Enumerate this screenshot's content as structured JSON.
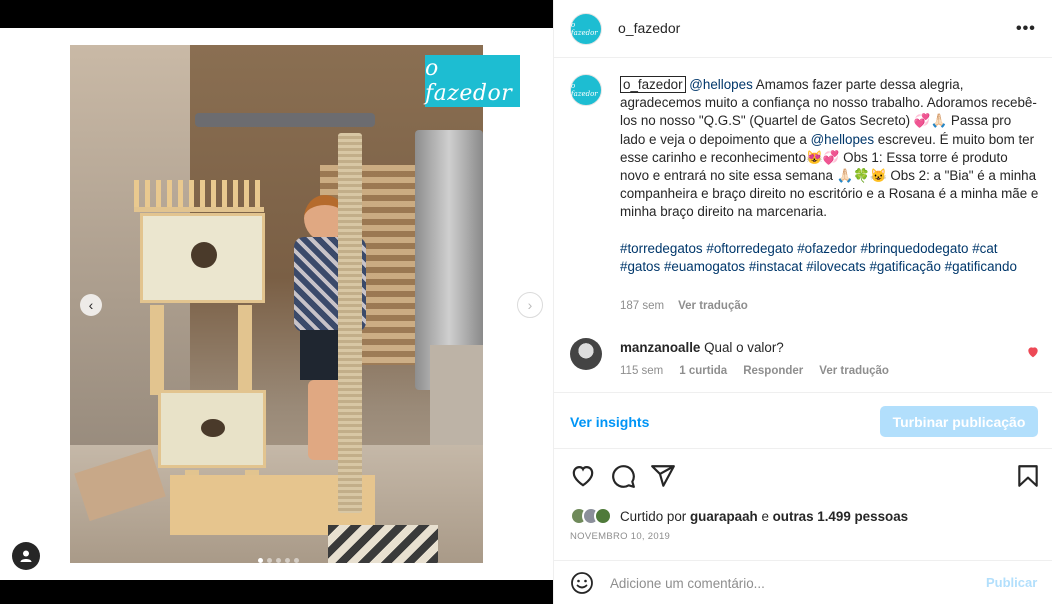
{
  "post": {
    "author": "o_fazedor",
    "logo_text": "o fazedor",
    "more_label": "•••"
  },
  "caption": {
    "username": "o_fazedor",
    "mention1": "@hellopes",
    "text1": " Amamos fazer parte dessa alegria, agradecemos muito a confiança no nosso trabalho. Adoramos recebê-los no nosso \"Q.G.S\" (Quartel de Gatos Secreto) 💞🙏🏻 Passa pro lado e veja o depoimento que a ",
    "mention2": "@hellopes",
    "text2": " escreveu. É muito bom ter esse carinho e reconhecimento😻💞 Obs 1: Essa torre é produto novo e entrará no site essa semana 🙏🏻🍀😺 Obs 2: a \"Bia\" é a minha companheira e braço direito no escritório e a Rosana é a minha mãe e minha braço direito na marcenaria.",
    "hashtags": [
      "#torredegatos",
      "#oftorredegato",
      "#ofazedor",
      "#brinquedodegato",
      "#cat",
      "#gatos",
      "#euamogatos",
      "#instacat",
      "#ilovecats",
      "#gatificação",
      "#gatificando"
    ],
    "time": "187 sem",
    "see_translation": "Ver tradução"
  },
  "comment": {
    "username": "manzanoalle",
    "text": "Qual o valor?",
    "time": "115 sem",
    "likes": "1 curtida",
    "reply": "Responder",
    "see_translation": "Ver tradução"
  },
  "insights": {
    "link": "Ver insights",
    "boost": "Turbinar publicação"
  },
  "likes": {
    "prefix": "Curtido por",
    "user": "guarapaah",
    "connector": "e",
    "others": "outras 1.499 pessoas"
  },
  "date": "NOVEMBRO 10, 2019",
  "comment_box": {
    "placeholder": "Adicione um comentário...",
    "publish": "Publicar"
  },
  "colors": {
    "brand": "#1dbdd2",
    "link": "#00376b",
    "primary": "#0095f6",
    "primary_disabled": "#b2dffc",
    "like_red": "#ed4956"
  }
}
